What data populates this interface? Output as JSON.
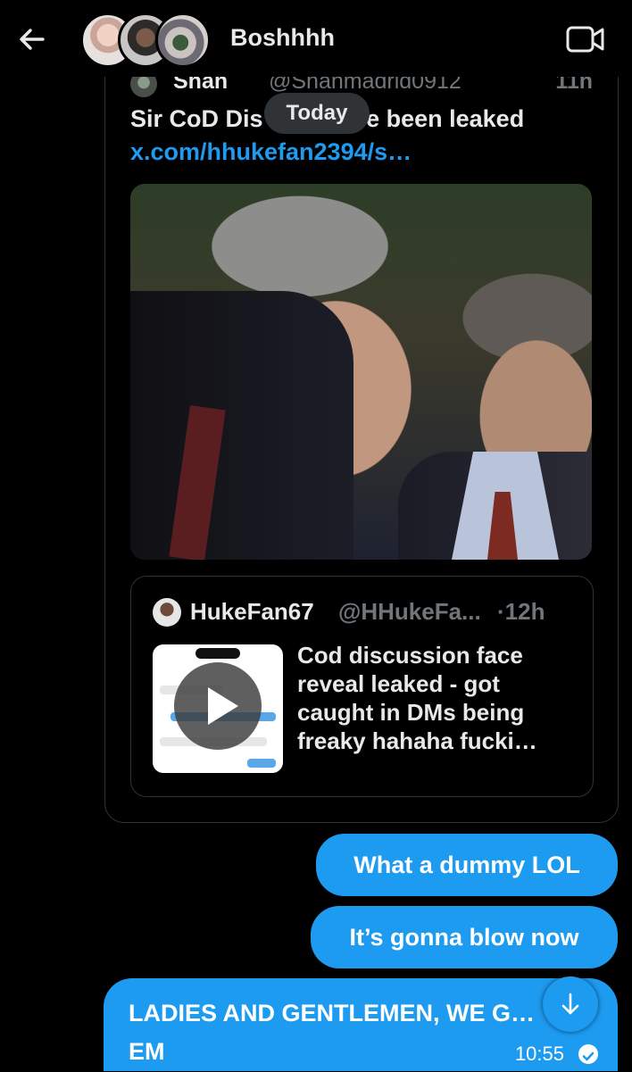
{
  "header": {
    "chat_name": "Boshhhh",
    "avatars": [
      "member-1",
      "member-2",
      "member-3"
    ]
  },
  "date_separator": "Today",
  "shared_tweet": {
    "author_name": "Shah",
    "author_handle": "@Shahmadrid0912",
    "time": "11h",
    "text_before": "Sir CoD Dis",
    "text_after": " files have been leaked ",
    "link": "x.com/hhukefan2394/s…"
  },
  "quoted_tweet": {
    "author_name": "HukeFan67",
    "author_handle": "@HHukeFa...",
    "time": "·12h",
    "text": "Cod discussion face reveal leaked - got caught in DMs being freaky hahaha fucki…"
  },
  "messages": [
    {
      "text": "What a dummy LOL"
    },
    {
      "text": "It’s gonna blow now"
    },
    {
      "text": "LADIES AND GENTLEMEN, WE G… EM",
      "time": "10:55"
    }
  ],
  "colors": {
    "accent": "#1d9bf0",
    "background": "#000000",
    "border": "#2f3336",
    "secondary_text": "#71767b"
  },
  "icons": {
    "back": "arrow-left-icon",
    "video": "video-camera-icon",
    "play": "play-icon",
    "scroll": "arrow-down-icon",
    "read": "check-circle-icon"
  }
}
